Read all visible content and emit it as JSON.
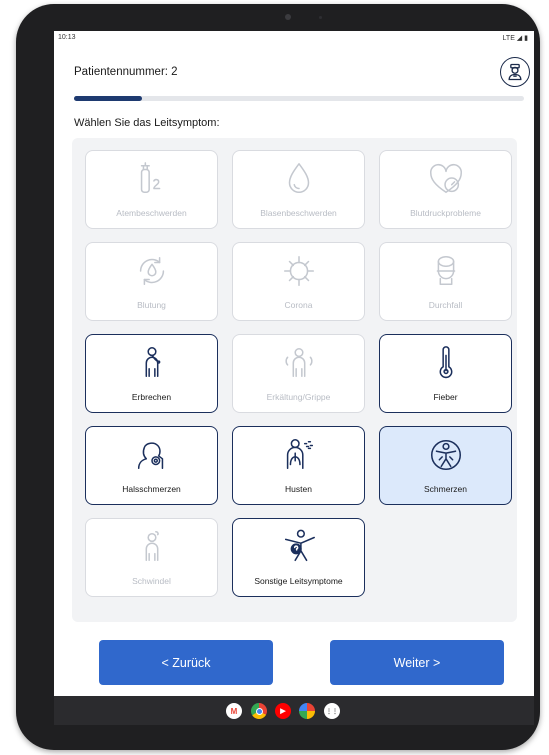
{
  "status_bar": {
    "time": "10:13",
    "right": "LTE ◢ ▮"
  },
  "header": {
    "patient_label": "Patientennummer: 2"
  },
  "progress": {
    "fraction": 0.15
  },
  "prompt": "Wählen Sie das Leitsymptom:",
  "symptoms": [
    {
      "label": "Atembeschwerden",
      "icon": "oxygen-tank-icon",
      "state": "disabled"
    },
    {
      "label": "Blasenbeschwerden",
      "icon": "droplet-icon",
      "state": "disabled"
    },
    {
      "label": "Blutdruckprobleme",
      "icon": "heart-gauge-icon",
      "state": "disabled"
    },
    {
      "label": "Blutung",
      "icon": "blood-cycle-icon",
      "state": "disabled"
    },
    {
      "label": "Corona",
      "icon": "virus-icon",
      "state": "disabled"
    },
    {
      "label": "Durchfall",
      "icon": "toilet-icon",
      "state": "disabled"
    },
    {
      "label": "Erbrechen",
      "icon": "vomiting-person-icon",
      "state": "active"
    },
    {
      "label": "Erkältung/Grippe",
      "icon": "cold-person-icon",
      "state": "disabled"
    },
    {
      "label": "Fieber",
      "icon": "thermometer-icon",
      "state": "active"
    },
    {
      "label": "Halsschmerzen",
      "icon": "sore-throat-icon",
      "state": "active"
    },
    {
      "label": "Husten",
      "icon": "lungs-cough-icon",
      "state": "active"
    },
    {
      "label": "Schmerzen",
      "icon": "pain-body-icon",
      "state": "selected"
    },
    {
      "label": "Schwindel",
      "icon": "dizzy-person-icon",
      "state": "disabled"
    },
    {
      "label": "Sonstige Leitsymptome",
      "icon": "person-question-icon",
      "state": "active"
    }
  ],
  "buttons": {
    "back": "< Zurück",
    "next": "Weiter >"
  },
  "colors": {
    "primary_button": "#3068cc",
    "accent_dark": "#1b2f5c",
    "selected_bg": "#dce9fb"
  },
  "dock": [
    {
      "name": "gmail-icon",
      "letter": "M",
      "color": "#ea4335"
    },
    {
      "name": "chrome-icon",
      "letter": "",
      "color": "#fbbc05"
    },
    {
      "name": "youtube-icon",
      "letter": "▶",
      "color": "#ff0000"
    },
    {
      "name": "photos-icon",
      "letter": "",
      "color": "#4285f4"
    },
    {
      "name": "apps-icon",
      "letter": "⋮⋮",
      "color": "#ffffff"
    }
  ]
}
